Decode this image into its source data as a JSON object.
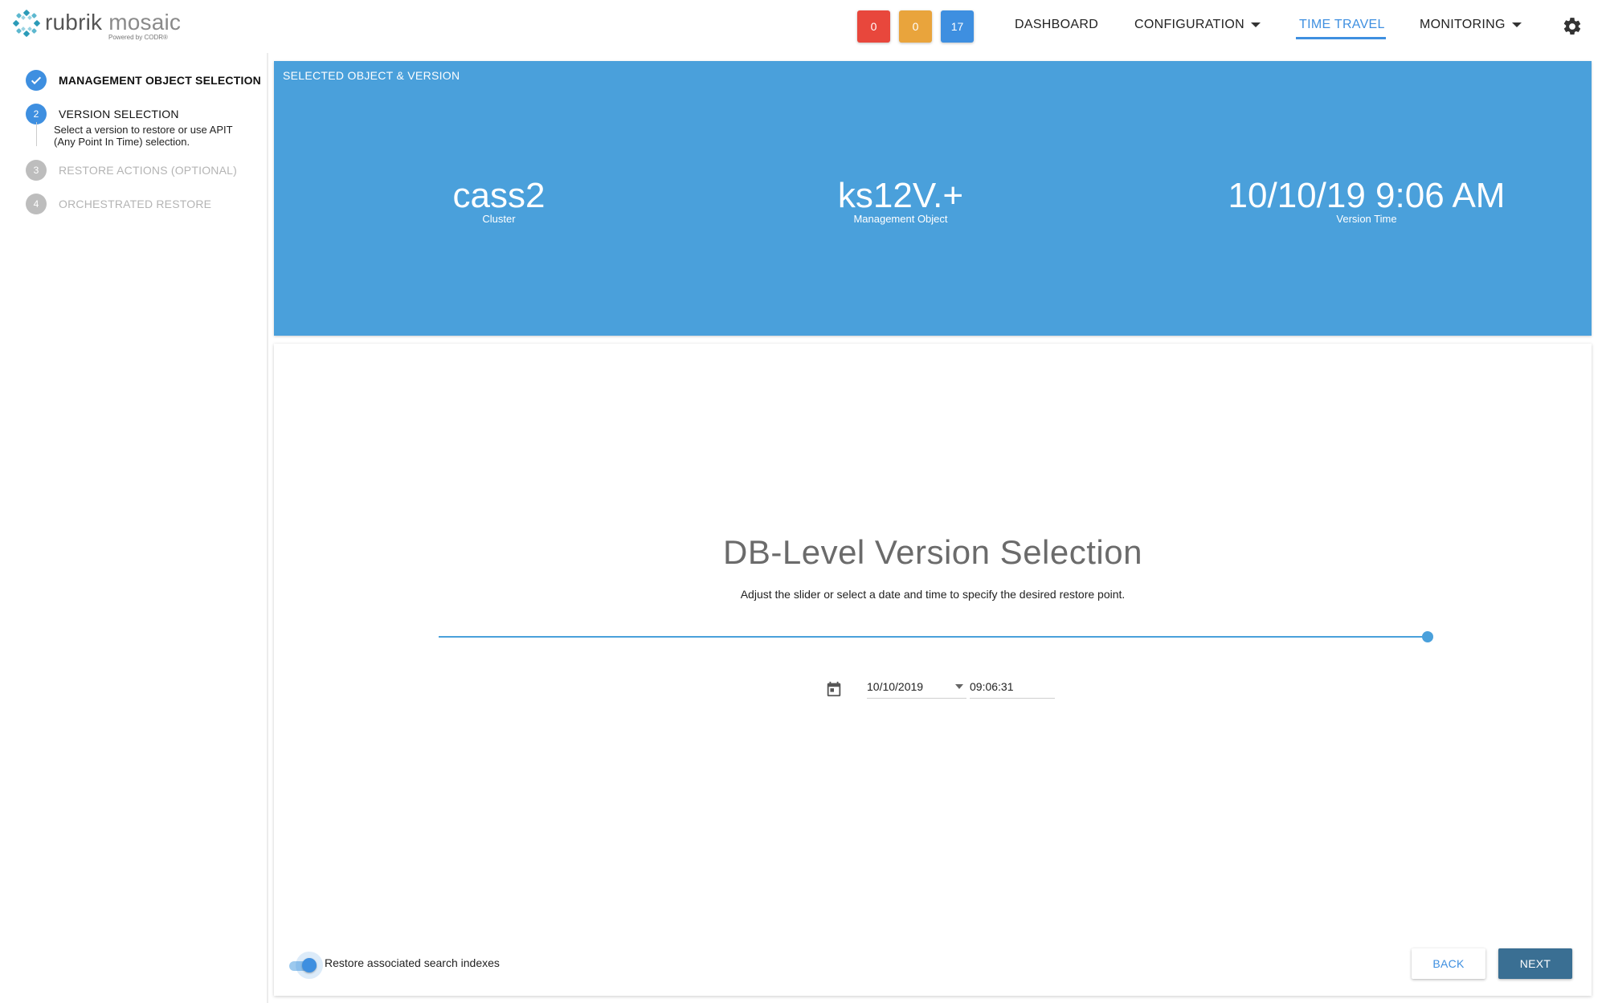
{
  "app": {
    "logo_primary": "rubrik",
    "logo_secondary": "mosaic",
    "logo_sub": "Powered by CODR®"
  },
  "header": {
    "badges": {
      "red": "0",
      "orange": "0",
      "blue": "17"
    },
    "nav": {
      "dashboard": "DASHBOARD",
      "configuration": "CONFIGURATION",
      "time_travel": "TIME TRAVEL",
      "monitoring": "MONITORING"
    },
    "active_nav": "TIME TRAVEL",
    "colors": {
      "accent": "#3e8fe0",
      "red": "#e8473c",
      "orange": "#e9a43c"
    },
    "icons": {
      "settings": "gear-icon"
    }
  },
  "stepper": {
    "steps": [
      {
        "number": "1",
        "label": "MANAGEMENT OBJECT SELECTION",
        "state": "done"
      },
      {
        "number": "2",
        "label": "VERSION SELECTION",
        "state": "active",
        "description": "Select a version to restore or use APIT (Any Point In Time) selection."
      },
      {
        "number": "3",
        "label": "RESTORE ACTIONS (OPTIONAL)",
        "state": "pending"
      },
      {
        "number": "4",
        "label": "ORCHESTRATED RESTORE",
        "state": "pending"
      }
    ]
  },
  "summary": {
    "title": "SELECTED OBJECT & VERSION",
    "cluster": {
      "value": "cass2",
      "label": "Cluster"
    },
    "management_object": {
      "value": "ks12V.+",
      "label": "Management Object"
    },
    "version_time": {
      "value": "10/10/19 9:06 AM",
      "label": "Version Time"
    },
    "color": "#4aa0db"
  },
  "version_selection": {
    "title": "DB-Level Version Selection",
    "subtitle": "Adjust the slider or select a date and time to specify the desired restore point.",
    "slider_position_fraction": 1.0,
    "date": "10/10/2019",
    "time": "09:06:31"
  },
  "footer": {
    "toggle_label": "Restore associated search indexes",
    "toggle_on": true,
    "back": "BACK",
    "next": "NEXT"
  }
}
